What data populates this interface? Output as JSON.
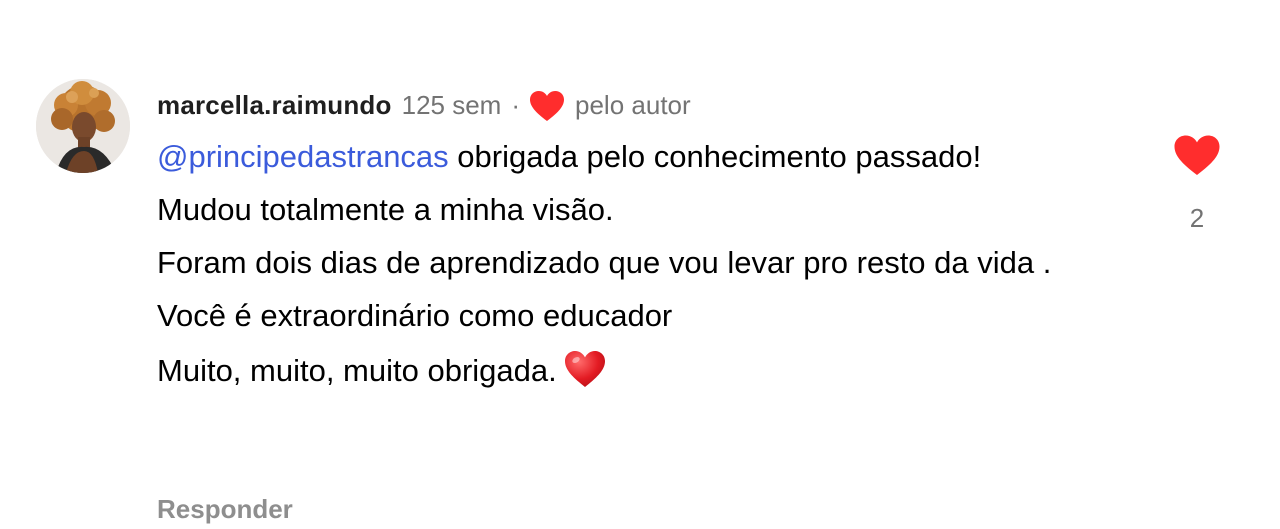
{
  "comment": {
    "username": "marcella.raimundo",
    "timestamp": "125 sem",
    "separator": "·",
    "liked_by_author_label": "pelo autor",
    "mention": "@principedastrancas",
    "paragraphs": [
      " obrigada pelo conhecimento passado!",
      "Mudou totalmente a minha visão.",
      "Foram dois dias de aprendizado que vou levar pro resto da vida .",
      "Você é extraordinário como educador",
      "Muito, muito, muito obrigada."
    ],
    "reply_label": "Responder",
    "like_count": "2"
  },
  "icons": {
    "author_heart": "heart-icon",
    "inline_heart": "red-heart-emoji-icon",
    "like_heart": "heart-filled-icon"
  },
  "colors": {
    "heart_red": "#ff2d2d",
    "mention_blue": "#3b5bdb",
    "meta_gray": "#737373",
    "reply_gray": "#8e8e8e"
  }
}
